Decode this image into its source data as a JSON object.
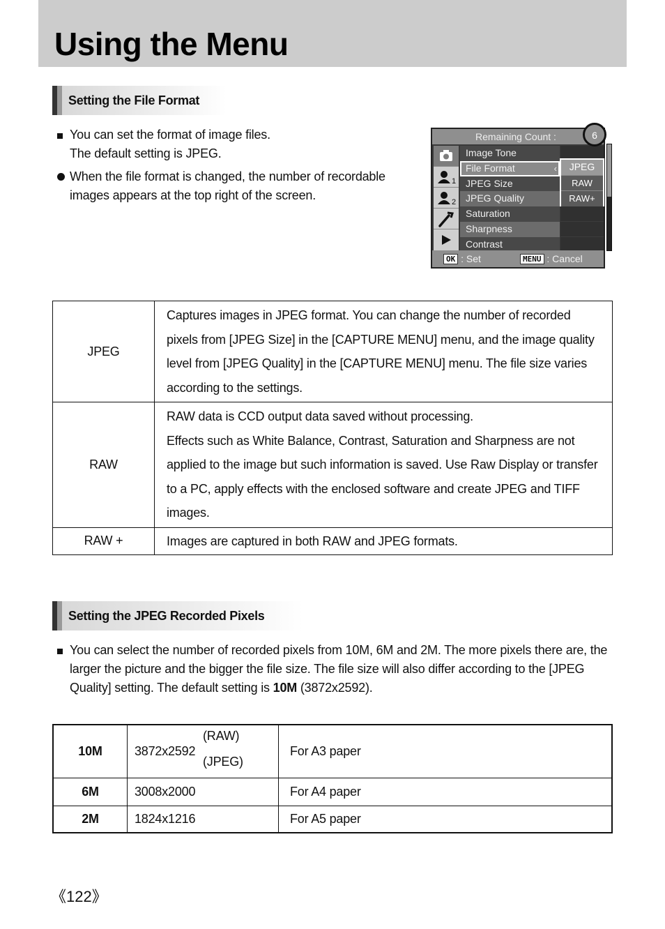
{
  "header": {
    "title": "Using the Menu"
  },
  "section1": {
    "heading": "Setting the File Format",
    "bullets": [
      {
        "marker": "square",
        "lines": [
          "You can set the format of image files.",
          "The default setting is JPEG."
        ]
      },
      {
        "marker": "circle",
        "lines": [
          "When the file format is changed, the number of recordable",
          "images appears at the top right of the screen."
        ]
      }
    ]
  },
  "camera_screen": {
    "header_label": "Remaining Count :",
    "remaining_count": "6",
    "tab_icons": [
      {
        "icon": "camera-icon",
        "label": ""
      },
      {
        "icon": "user-icon",
        "label": "1"
      },
      {
        "icon": "user-icon",
        "label": "2"
      },
      {
        "icon": "wrench-icon",
        "label": ""
      },
      {
        "icon": "play-icon",
        "label": ""
      }
    ],
    "menu_items": [
      "Image Tone",
      "File Format",
      "JPEG Size",
      "JPEG Quality",
      "Saturation",
      "Sharpness",
      "Contrast"
    ],
    "selected_item": "File Format",
    "options": [
      "JPEG",
      "RAW",
      "RAW+"
    ],
    "selected_option": "JPEG",
    "footer": {
      "ok_key": "OK",
      "ok_label": ": Set",
      "menu_key": "MENU",
      "menu_label": ": Cancel"
    }
  },
  "format_table": [
    {
      "format": "JPEG",
      "description": [
        "Captures images in JPEG format. You can change the number of recorded pixels from [JPEG Size] in the [CAPTURE MENU] menu, and the image quality level from [JPEG Quality] in the [CAPTURE MENU] menu. The file size varies according to the settings."
      ]
    },
    {
      "format": "RAW",
      "description": [
        "RAW data is CCD output data saved without processing.",
        "Effects such as White Balance, Contrast, Saturation and Sharpness are not applied to the image but such information is saved. Use Raw Display or transfer to a PC, apply effects with the enclosed software and create JPEG and TIFF images."
      ]
    },
    {
      "format": "RAW +",
      "description": [
        "Images are captured in both RAW and JPEG formats."
      ]
    }
  ],
  "section2": {
    "heading": "Setting the JPEG Recorded Pixels",
    "bullet_pre": "You can select the number of recorded pixels from 10M, 6M and 2M. The more pixels there are, the larger the picture and the bigger the file size. The file size will also differ according to the [JPEG Quality] setting. The default setting is ",
    "bullet_bold": "10M",
    "bullet_post": " (3872x2592)."
  },
  "pixels_table": [
    {
      "size": "10M",
      "resolution": "3872x2592",
      "note_top": "(RAW)",
      "note_bottom": "(JPEG)",
      "usage": "For A3 paper"
    },
    {
      "size": "6M",
      "resolution": "3008x2000",
      "usage": "For A4 paper"
    },
    {
      "size": "2M",
      "resolution": "1824x1216",
      "usage": "For A5 paper"
    }
  ],
  "footer": {
    "page_number": "《122》"
  }
}
